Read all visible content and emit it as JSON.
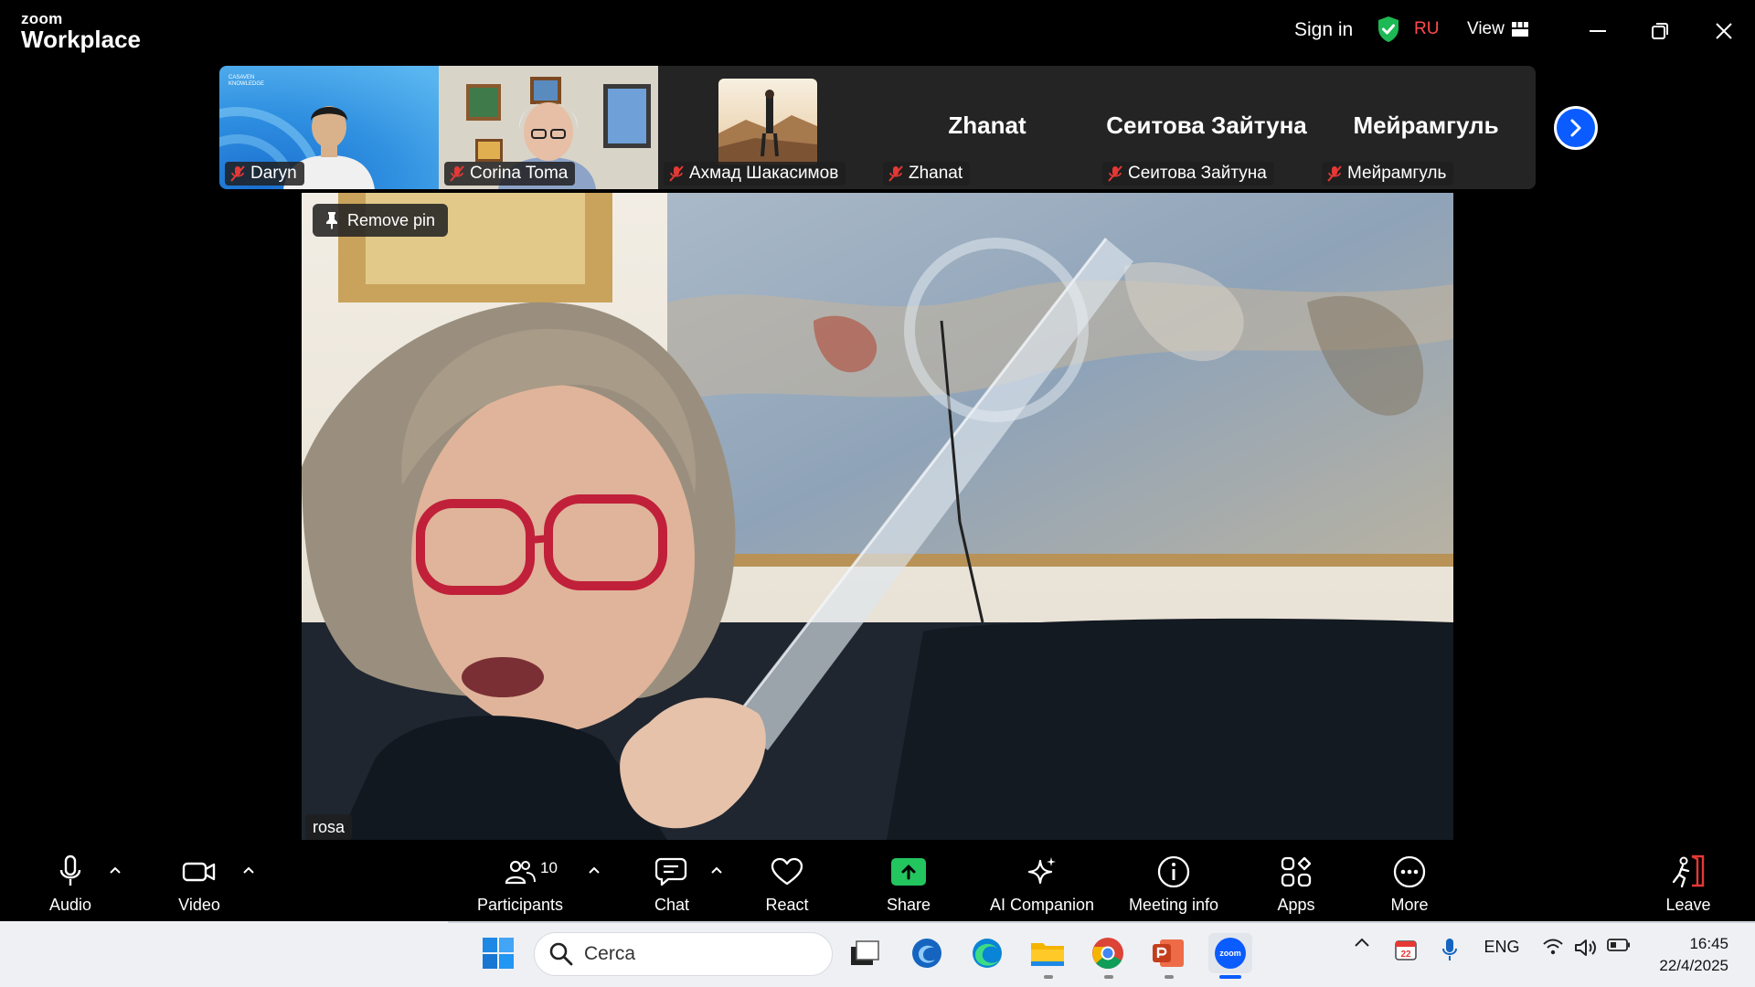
{
  "window": {
    "brand_line1": "zoom",
    "brand_line2": "Workplace",
    "sign_in": "Sign in",
    "region": "RU",
    "view_label": "View"
  },
  "filmstrip": {
    "participants": [
      {
        "name": "Daryn",
        "has_video": true
      },
      {
        "name": "Corina Toma",
        "has_video": true
      },
      {
        "name": "Ахмад Шакасимов",
        "has_video": false,
        "avatar": true
      },
      {
        "name": "Zhanat",
        "big_name": "Zhanat",
        "has_video": false
      },
      {
        "name": "Сеитова Зайтуна",
        "big_name": "Сеитова Зайтуна",
        "has_video": false
      },
      {
        "name": "Мейрамгуль",
        "big_name": "Мейрамгуль",
        "has_video": false
      }
    ],
    "muted_color": "#e53935"
  },
  "main_video": {
    "remove_pin": "Remove pin",
    "speaker_name": "rosa"
  },
  "toolbar": {
    "audio": "Audio",
    "video": "Video",
    "participants": "Participants",
    "participants_count": "10",
    "chat": "Chat",
    "react": "React",
    "share": "Share",
    "ai_companion": "AI Companion",
    "meeting_info": "Meeting info",
    "apps": "Apps",
    "more": "More",
    "leave": "Leave",
    "share_color": "#22c55e",
    "leave_color": "#e53935"
  },
  "taskbar": {
    "search_placeholder": "Cerca",
    "language": "ENG",
    "time": "16:45",
    "date": "22/4/2025",
    "calendar_badge": "22"
  }
}
